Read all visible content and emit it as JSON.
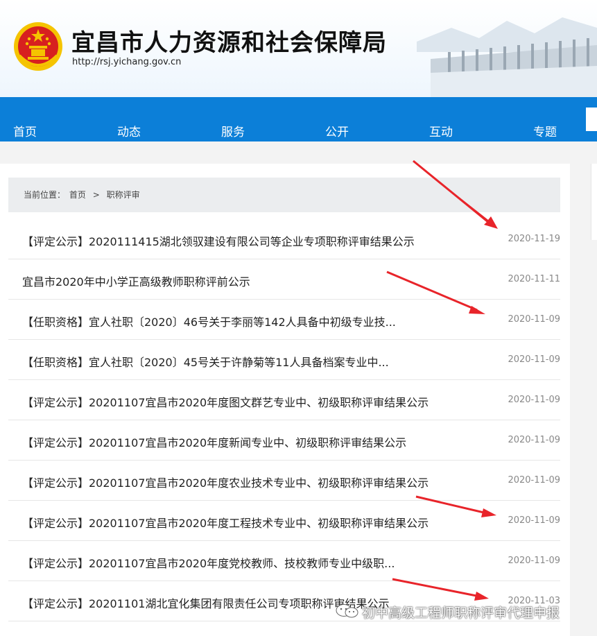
{
  "header": {
    "title": "宜昌市人力资源和社会保障局",
    "url": "http://rsj.yichang.gov.cn"
  },
  "nav": {
    "items": [
      "首页",
      "动态",
      "服务",
      "公开",
      "互动",
      "专题"
    ]
  },
  "breadcrumb": {
    "prefix": "当前位置：",
    "home": "首页",
    "separator": ">",
    "current": "职称评审"
  },
  "articles": [
    {
      "title": "【评定公示】2020111415湖北领驭建设有限公司等企业专项职称评审结果公示",
      "date": "2020-11-19"
    },
    {
      "title": "宜昌市2020年中小学正高级教师职称评前公示",
      "date": "2020-11-11"
    },
    {
      "title": "【任职资格】宜人社职〔2020〕46号关于李丽等142人具备中初级专业技...",
      "date": "2020-11-09"
    },
    {
      "title": "【任职资格】宜人社职〔2020〕45号关于许静菊等11人具备档案专业中...",
      "date": "2020-11-09"
    },
    {
      "title": "【评定公示】20201107宜昌市2020年度图文群艺专业中、初级职称评审结果公示",
      "date": "2020-11-09"
    },
    {
      "title": "【评定公示】20201107宜昌市2020年度新闻专业中、初级职称评审结果公示",
      "date": "2020-11-09"
    },
    {
      "title": "【评定公示】20201107宜昌市2020年度农业技术专业中、初级职称评审结果公示",
      "date": "2020-11-09"
    },
    {
      "title": "【评定公示】20201107宜昌市2020年度工程技术专业中、初级职称评审结果公示",
      "date": "2020-11-09"
    },
    {
      "title": "【评定公示】20201107宜昌市2020年度党校教师、技校教师专业中级职...",
      "date": "2020-11-09"
    },
    {
      "title": "【评定公示】20201101湖北宜化集团有限责任公司专项职称评审结果公示",
      "date": "2020-11-03"
    }
  ],
  "watermark": {
    "text": "初中高级工程师职称评审代理申报",
    "icon": "wechat-icon"
  },
  "colors": {
    "nav_blue": "#0c7fd8",
    "arrow_red": "#e8242a",
    "emblem_red": "#d7201f",
    "emblem_gold": "#f5c400"
  }
}
